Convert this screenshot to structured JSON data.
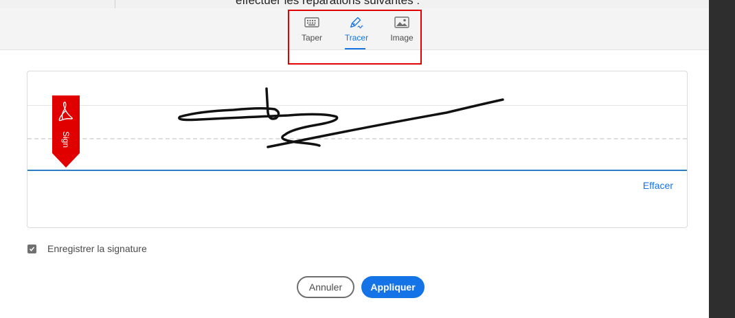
{
  "background": {
    "document_text": "effectuer les réparations suivantes :"
  },
  "tabs": [
    {
      "label": "Taper",
      "icon": "keyboard-icon",
      "active": false
    },
    {
      "label": "Tracer",
      "icon": "pen-draw-icon",
      "active": true
    },
    {
      "label": "Image",
      "icon": "image-icon",
      "active": false
    }
  ],
  "signature": {
    "flag_text": "Sign",
    "clear_label": "Effacer"
  },
  "save": {
    "label": "Enregistrer la signature",
    "checked": true
  },
  "buttons": {
    "cancel_label": "Annuler",
    "apply_label": "Appliquer"
  },
  "colors": {
    "accent": "#1473e6",
    "highlight": "#e00000",
    "flag": "#e00000"
  }
}
